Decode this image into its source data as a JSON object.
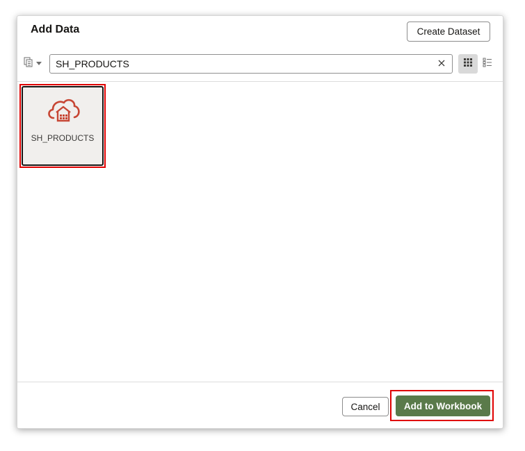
{
  "dialog": {
    "title": "Add Data",
    "create_dataset_label": "Create Dataset"
  },
  "toolbar": {
    "source_picker_icon": "data-source-icon",
    "search": {
      "value": "SH_PRODUCTS",
      "placeholder": ""
    },
    "clear_icon": "close-icon",
    "views": [
      "grid-view-icon",
      "list-view-icon"
    ],
    "selected_view": "grid"
  },
  "results": [
    {
      "label": "SH_PRODUCTS",
      "icon": "cloud-warehouse-icon",
      "selected": true
    }
  ],
  "footer": {
    "cancel_label": "Cancel",
    "add_label": "Add to Workbook"
  },
  "colors": {
    "accent": "#5a7a4a",
    "icon": "#c74634",
    "highlight": "#e00000"
  }
}
